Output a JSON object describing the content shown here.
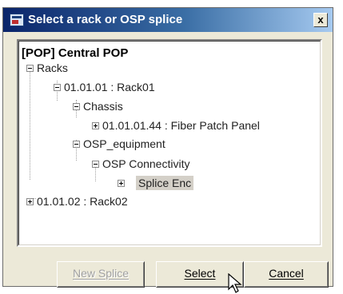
{
  "window": {
    "title": "Select a rack or OSP splice",
    "close_label": "x"
  },
  "tree": {
    "root": "[POP] Central POP",
    "nodes": [
      {
        "label": "Racks",
        "expander": "minus"
      },
      {
        "label": "01.01.01 : Rack01",
        "expander": "minus"
      },
      {
        "label": "Chassis",
        "expander": "minus"
      },
      {
        "label": "01.01.01.44 : Fiber Patch Panel",
        "expander": "plus"
      },
      {
        "label": "OSP_equipment",
        "expander": "minus"
      },
      {
        "label": "OSP Connectivity",
        "expander": "minus"
      },
      {
        "label": "Splice Enc",
        "expander": "plus",
        "selected": true
      },
      {
        "label": "01.01.02 : Rack02",
        "expander": "plus"
      }
    ]
  },
  "buttons": {
    "new_splice": "New Splice",
    "select": "Select",
    "cancel": "Cancel"
  },
  "colors": {
    "dialog_bg": "#ece9d8",
    "titlebar_start": "#0a246a",
    "titlebar_end": "#a6caf0",
    "selection_bg": "#d4d0c8"
  }
}
